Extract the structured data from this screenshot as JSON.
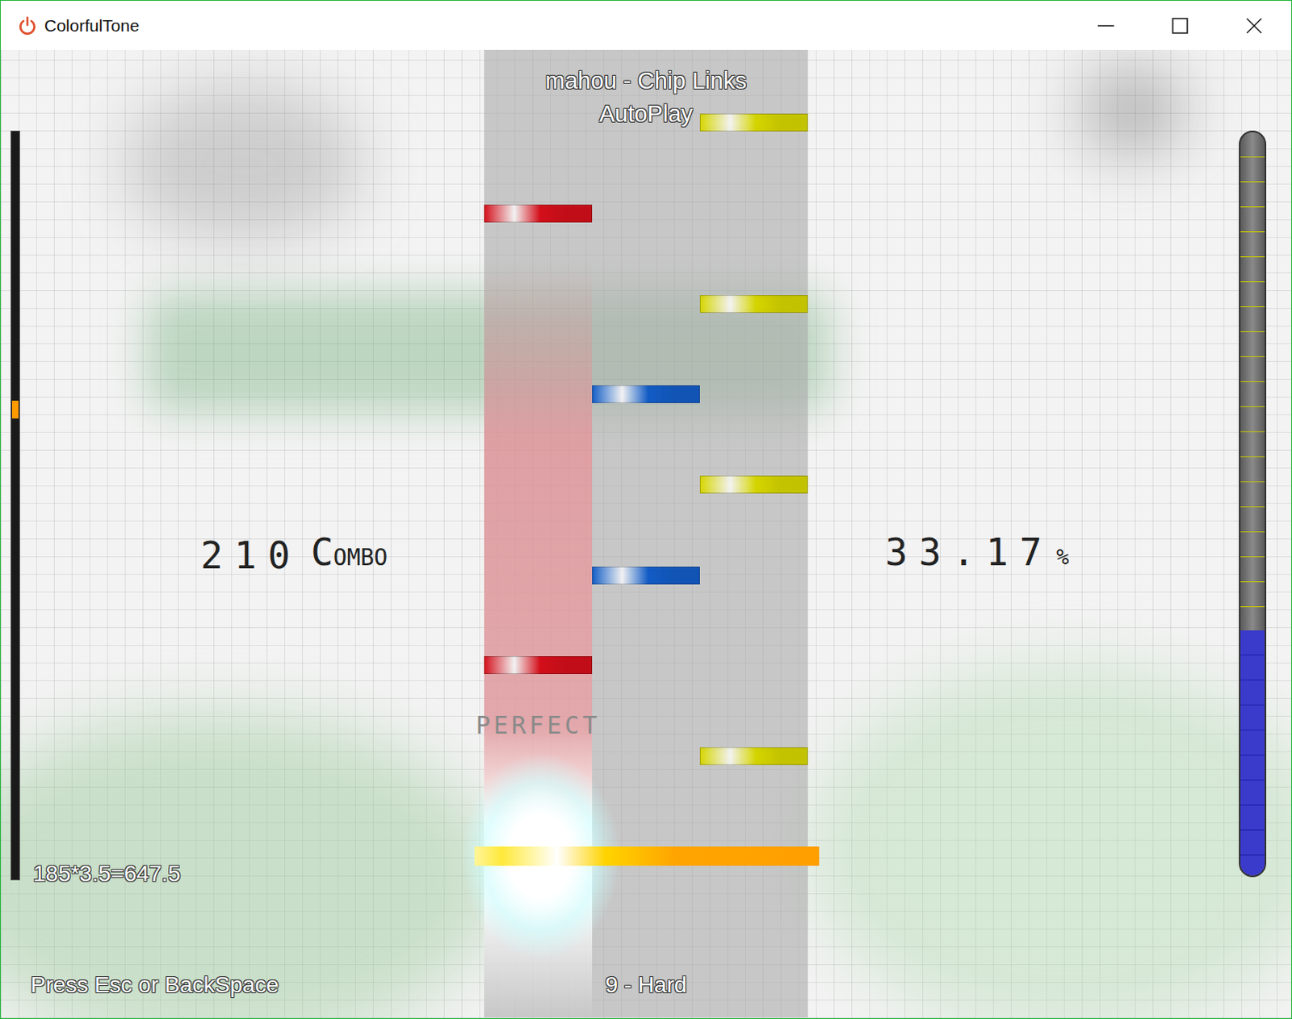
{
  "window": {
    "title": "ColorfulTone"
  },
  "song": {
    "title": "mahou - Chip Links",
    "mode": "AutoPlay",
    "difficulty": "9 - Hard"
  },
  "lanes": [
    {
      "color": "#e0101c",
      "lit": true
    },
    {
      "color": "#1462d2",
      "lit": false
    },
    {
      "color": "#e2e200",
      "lit": false
    }
  ],
  "notes": [
    {
      "lane": 2,
      "distance": 0.91
    },
    {
      "lane": 0,
      "distance": 0.797
    },
    {
      "lane": 2,
      "distance": 0.685
    },
    {
      "lane": 1,
      "distance": 0.573
    },
    {
      "lane": 2,
      "distance": 0.461
    },
    {
      "lane": 1,
      "distance": 0.348
    },
    {
      "lane": 0,
      "distance": 0.237
    },
    {
      "lane": 2,
      "distance": 0.124
    }
  ],
  "combo": {
    "count": "210",
    "label": "COMBO"
  },
  "accuracy": {
    "value": "33.17",
    "unit": "%"
  },
  "judgment": "PERFECT",
  "speed": "185*3.5=647.5",
  "hint": "Press Esc or BackSpace",
  "progress": {
    "level": 0.36
  },
  "gauge": {
    "level": 0.33
  }
}
